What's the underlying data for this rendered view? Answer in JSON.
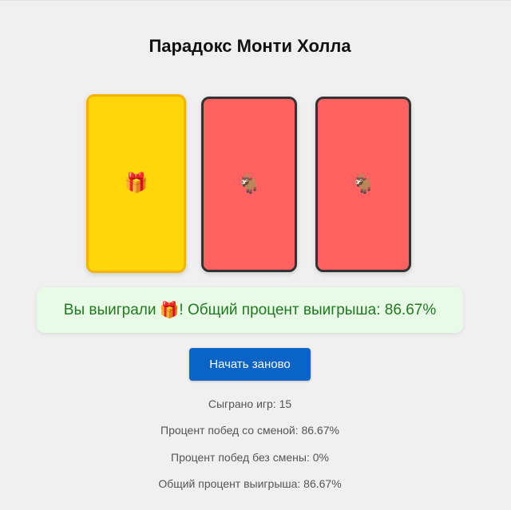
{
  "title": "Парадокс Монти Холла",
  "doors": [
    {
      "content": "🎁",
      "icon_name": "gift-icon",
      "state": "winner",
      "color": "#ffd60a"
    },
    {
      "content": "🐐",
      "icon_name": "goat-icon",
      "state": "goat",
      "color": "#ff6161"
    },
    {
      "content": "🐐",
      "icon_name": "goat-icon",
      "state": "goat",
      "color": "#ff6161"
    }
  ],
  "result": {
    "prefix": "Вы выиграли",
    "icon": "🎁",
    "icon_name": "gift-icon",
    "suffix": "! Общий процент выигрыша: 86.67%"
  },
  "restart_label": "Начать заново",
  "stats": {
    "games_played": "Сыграно игр: 15",
    "switch_win_rate": "Процент побед со сменой: 86.67%",
    "stay_win_rate": "Процент побед без смены: 0%",
    "total_win_rate": "Общий процент выигрыша: 86.67%"
  },
  "colors": {
    "accent": "#0a64c8",
    "result_bg": "#e8fbe6",
    "result_text": "#1f7a1f"
  }
}
